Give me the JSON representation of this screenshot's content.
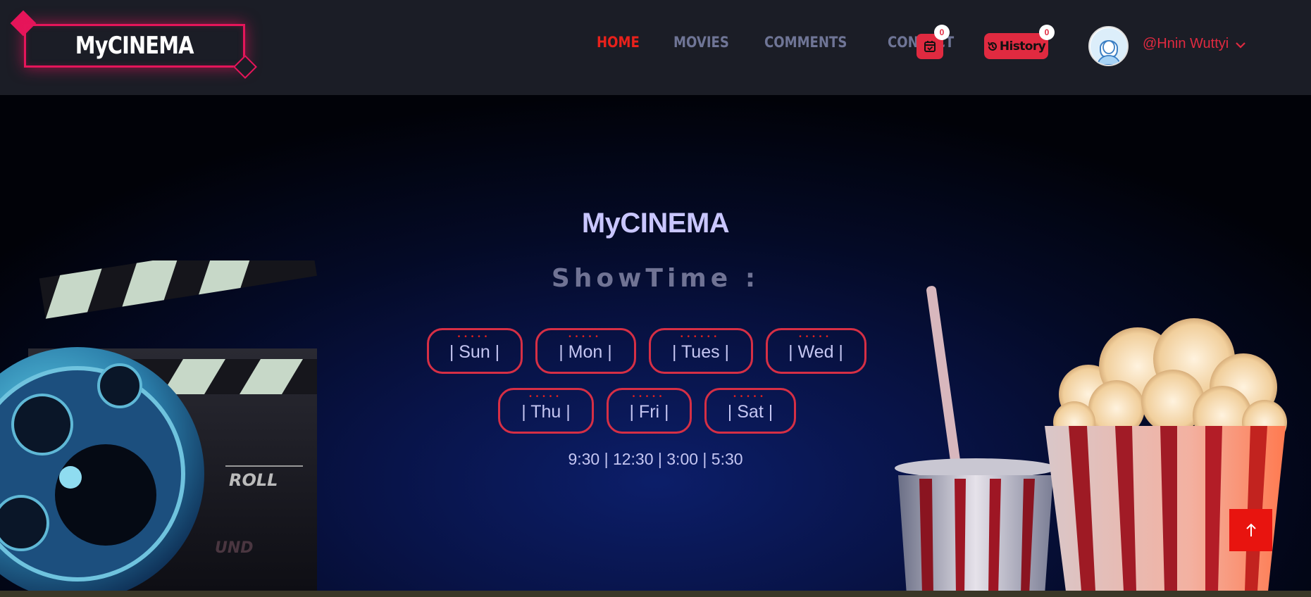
{
  "header": {
    "logo_text": "MyCINEMA",
    "nav": [
      {
        "label": "HOME",
        "active": true
      },
      {
        "label": "MOVIES",
        "active": false
      },
      {
        "label": "COMMENTS",
        "active": false
      },
      {
        "label": "CONTACT",
        "active": false
      }
    ],
    "cart_icon": "calendar-check-icon",
    "cart_count": "0",
    "history_label": "History",
    "history_icon": "history-icon",
    "history_count": "0",
    "avatar_icon": "user-avatar-icon",
    "username": "@Hnin Wuttyi",
    "dropdown_icon": "chevron-down-icon"
  },
  "hero": {
    "logo_text": "MyCINEMA",
    "title": "ShowTime :",
    "days_row1": [
      "| Sun |",
      "| Mon |",
      "| Tues |",
      "| Wed |"
    ],
    "days_row2": [
      "| Thu |",
      "| Fri |",
      "| Sat |"
    ],
    "times": "9:30 | 12:30 | 3:00 | 5:30",
    "decor": [
      "film-clapperboard-icon",
      "film-reel-icon",
      "popcorn-icon",
      "soda-cup-icon"
    ]
  },
  "scroll_top_icon": "arrow-up-icon",
  "colors": {
    "accent": "#e8211b",
    "logo_neon": "#e6155a",
    "button_red": "#e02a40",
    "nav_inactive": "#6f7596",
    "header_bg": "#1b1d26",
    "text_light": "#c5c6f2"
  }
}
